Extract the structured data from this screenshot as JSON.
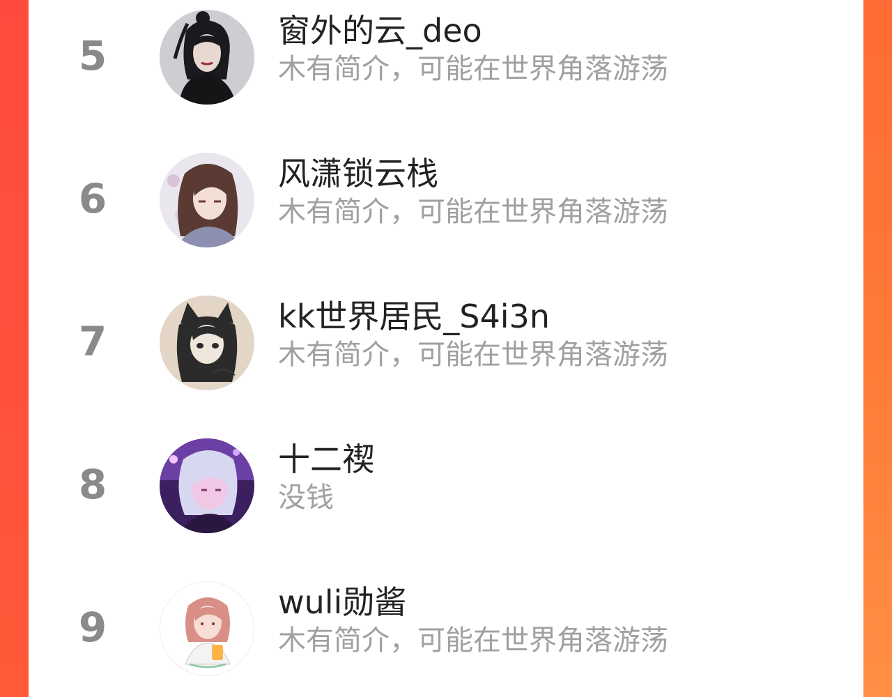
{
  "rankings": [
    {
      "rank": "5",
      "name": "窗外的云_deo",
      "bio": "木有简介，可能在世界角落游荡",
      "avatar_icon": "portrait-dark-hair-avatar"
    },
    {
      "rank": "6",
      "name": "风潇锁云栈",
      "bio": "木有简介，可能在世界角落游荡",
      "avatar_icon": "anime-long-hair-avatar"
    },
    {
      "rank": "7",
      "name": "kk世界居民_S4i3n",
      "bio": "木有简介，可能在世界角落游荡",
      "avatar_icon": "sketch-cat-ears-avatar"
    },
    {
      "rank": "8",
      "name": "十二禊",
      "bio": "没钱",
      "avatar_icon": "anime-white-hair-avatar"
    },
    {
      "rank": "9",
      "name": "wuli勋酱",
      "bio": "木有简介，可能在世界角落游荡",
      "avatar_icon": "cartoon-girl-drink-avatar"
    }
  ],
  "colors": {
    "left_band": "#ff4b3d",
    "right_band": "#ff7a36",
    "rank_text": "#8a8a8a",
    "name_text": "#222222",
    "bio_text": "#a0a0a0"
  }
}
